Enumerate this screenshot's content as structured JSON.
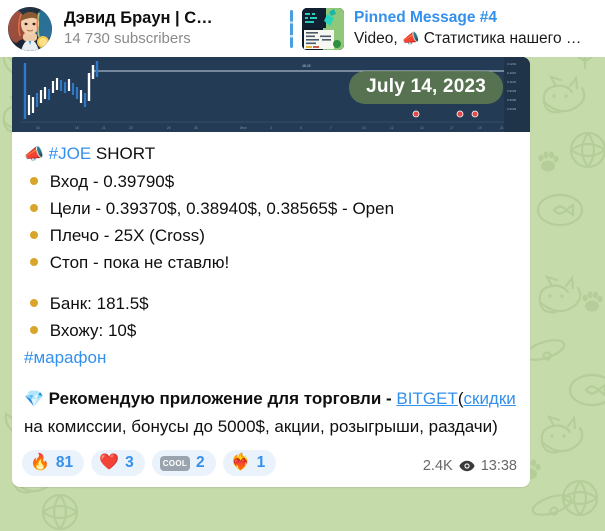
{
  "header": {
    "channel": {
      "avatar_icon": "man-portrait-avatar",
      "title": "Дэвид Браун | С…",
      "subscribers": "14 730 subscribers"
    },
    "pinned": {
      "thumb_icon": "video-thumbnail",
      "label": "Pinned Message #4",
      "type": "Video,",
      "megaphone_icon": "megaphone-emoji",
      "preview": "Статистика нашего …"
    }
  },
  "message": {
    "chart": {
      "date_badge": "July 14, 2023",
      "background_color": "#243b55"
    },
    "title": {
      "megaphone_icon": "megaphone-emoji",
      "ticker": "#JOE",
      "direction": "SHORT"
    },
    "bullets": [
      "Вход - 0.39790$",
      "Цели - 0.39370$, 0.38940$, 0.38565$ - Open",
      "Плечо - 25X (Cross)",
      "Стоп - пока не ставлю!"
    ],
    "bullets2": [
      "Банк: 181.5$",
      "Вхожу: 10$"
    ],
    "hashtag": "#марафон",
    "recommendation": {
      "gem_icon": "gem-emoji",
      "text_before": "Рекомендую приложение для торговли - ",
      "link_label": "BITGET",
      "paren_open": "(",
      "link2_label": "скидки",
      "text_after": " на комиссии, бонусы до 5000$, акции, розыгрыши, раздачи)"
    },
    "reactions": [
      {
        "icon": "fire-emoji",
        "glyph": "🔥",
        "count": "81"
      },
      {
        "icon": "red-heart-emoji",
        "glyph": "❤️",
        "count": "3"
      },
      {
        "icon": "cool-badge-emoji",
        "glyph": "COOL",
        "count": "2"
      },
      {
        "icon": "heart-on-fire-emoji",
        "glyph": "❤️‍🔥",
        "count": "1"
      }
    ],
    "meta": {
      "views": "2.4K",
      "views_icon": "eye-icon",
      "time": "13:38"
    }
  },
  "colors": {
    "accent_blue": "#3390ec",
    "wallpaper_green": "#c5dbaa",
    "bullet_gold": "#d9a62b",
    "badge_green": "#5f7c4f"
  }
}
